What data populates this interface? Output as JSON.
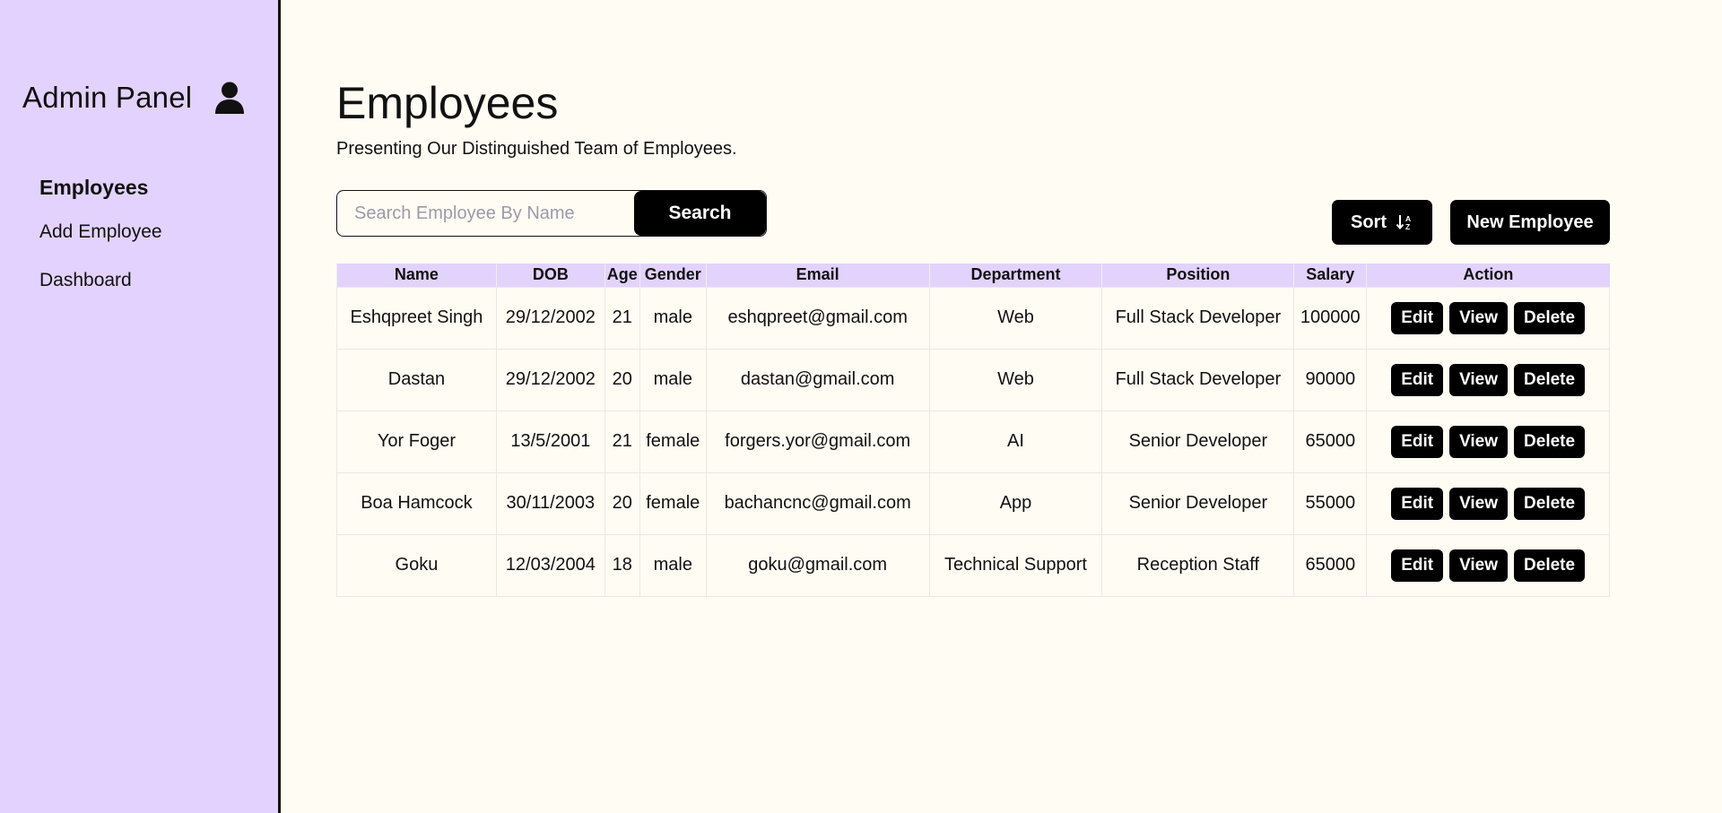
{
  "sidebar": {
    "title": "Admin Panel",
    "user_icon": "user-icon",
    "items": [
      {
        "label": "Employees",
        "active": true
      },
      {
        "label": "Add Employee",
        "active": false
      },
      {
        "label": "Dashboard",
        "active": false
      }
    ]
  },
  "main": {
    "title": "Employees",
    "subtitle": "Presenting Our Distinguished Team of Employees.",
    "search": {
      "placeholder": "Search Employee By Name",
      "value": "",
      "button_label": "Search"
    },
    "sort_label": "Sort",
    "sort_icon": "sort-ascending-icon",
    "new_employee_label": "New Employee"
  },
  "table": {
    "headers": [
      "Name",
      "DOB",
      "Age",
      "Gender",
      "Email",
      "Department",
      "Position",
      "Salary",
      "Action"
    ],
    "rows": [
      {
        "name": "Eshqpreet Singh",
        "dob": "29/12/2002",
        "age": "21",
        "gender": "male",
        "email": "eshqpreet@gmail.com",
        "department": "Web",
        "position": "Full Stack Developer",
        "salary": "100000"
      },
      {
        "name": "Dastan",
        "dob": "29/12/2002",
        "age": "20",
        "gender": "male",
        "email": "dastan@gmail.com",
        "department": "Web",
        "position": "Full Stack Developer",
        "salary": "90000"
      },
      {
        "name": "Yor Foger",
        "dob": "13/5/2001",
        "age": "21",
        "gender": "female",
        "email": "forgers.yor@gmail.com",
        "department": "AI",
        "position": "Senior Developer",
        "salary": "65000"
      },
      {
        "name": "Boa Hamcock",
        "dob": "30/11/2003",
        "age": "20",
        "gender": "female",
        "email": "bachancnc@gmail.com",
        "department": "App",
        "position": "Senior Developer",
        "salary": "55000"
      },
      {
        "name": "Goku",
        "dob": "12/03/2004",
        "age": "18",
        "gender": "male",
        "email": "goku@gmail.com",
        "department": "Technical Support",
        "position": "Reception Staff",
        "salary": "65000"
      }
    ],
    "action_labels": {
      "edit": "Edit",
      "view": "View",
      "delete": "Delete"
    }
  },
  "colors": {
    "sidebar_bg": "#e3d2fe",
    "page_bg": "#fffcf4",
    "button_bg": "#000000",
    "header_bg": "#e3d2fe"
  }
}
